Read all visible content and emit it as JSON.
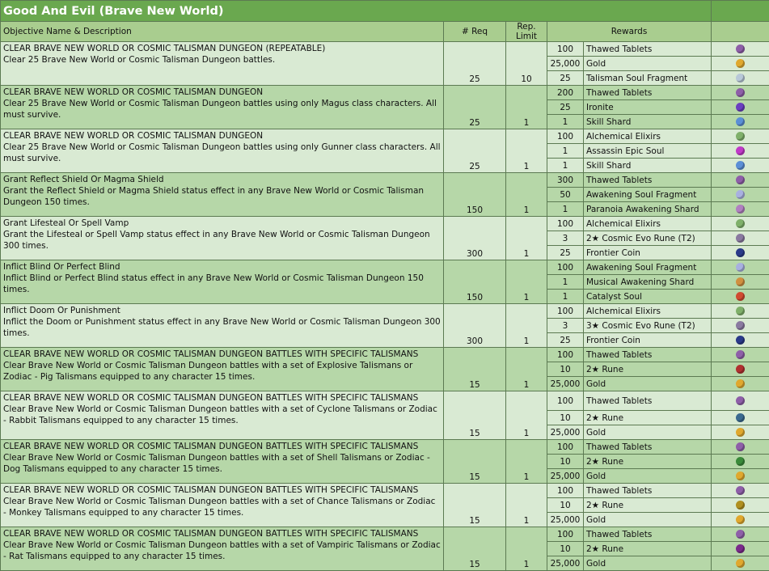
{
  "title": "Good And Evil (Brave New World)",
  "headers": {
    "objective": "Objective Name & Description",
    "req": "# Req",
    "limit": "Rep. Limit",
    "rewards": "Rewards"
  },
  "objectives": [
    {
      "name": "CLEAR BRAVE NEW WORLD OR COSMIC TALISMAN DUNGEON (REPEATABLE)",
      "description": "Clear 25 Brave New World or Cosmic Talisman Dungeon battles.",
      "req": "25",
      "limit": "10",
      "rewards": [
        {
          "amount": "100",
          "name": "Thawed Tablets",
          "icon": "thawed-tablets-icon",
          "color": "#8e5fa8"
        },
        {
          "amount": "25,000",
          "name": "Gold",
          "icon": "gold-icon",
          "color": "#e0a82e"
        },
        {
          "amount": "25",
          "name": "Talisman Soul Fragment",
          "icon": "talisman-soul-fragment-icon",
          "color": "#b8c8d8"
        }
      ]
    },
    {
      "name": "CLEAR BRAVE NEW WORLD OR COSMIC TALISMAN DUNGEON",
      "description": "Clear 25 Brave New World or Cosmic Talisman Dungeon battles using only Magus class characters. All must survive.",
      "req": "25",
      "limit": "1",
      "rewards": [
        {
          "amount": "200",
          "name": "Thawed Tablets",
          "icon": "thawed-tablets-icon",
          "color": "#8e5fa8"
        },
        {
          "amount": "25",
          "name": "Ironite",
          "icon": "ironite-icon",
          "color": "#6a3fc0"
        },
        {
          "amount": "1",
          "name": "Skill Shard",
          "icon": "skill-shard-icon",
          "color": "#5b8fd6"
        }
      ]
    },
    {
      "name": "CLEAR BRAVE NEW WORLD OR COSMIC TALISMAN DUNGEON",
      "description": "Clear 25 Brave New World or Cosmic Talisman Dungeon battles using only Gunner class characters. All must survive.",
      "req": "25",
      "limit": "1",
      "rewards": [
        {
          "amount": "100",
          "name": "Alchemical Elixirs",
          "icon": "alchemical-elixirs-icon",
          "color": "#7fb06a"
        },
        {
          "amount": "1",
          "name": "Assassin Epic Soul",
          "icon": "assassin-epic-soul-icon",
          "color": "#c03ac8"
        },
        {
          "amount": "1",
          "name": "Skill Shard",
          "icon": "skill-shard-icon",
          "color": "#5b8fd6"
        }
      ]
    },
    {
      "name": "Grant Reflect Shield Or Magma Shield",
      "description": "Grant the Reflect Shield or Magma Shield status effect in any Brave New World or Cosmic Talisman Dungeon 150 times.",
      "req": "150",
      "limit": "1",
      "rewards": [
        {
          "amount": "300",
          "name": "Thawed Tablets",
          "icon": "thawed-tablets-icon",
          "color": "#8e5fa8"
        },
        {
          "amount": "50",
          "name": "Awakening Soul Fragment",
          "icon": "awakening-soul-fragment-icon",
          "color": "#a8b0e0"
        },
        {
          "amount": "1",
          "name": "Paranoia Awakening Shard",
          "icon": "paranoia-awakening-shard-icon",
          "color": "#b080c0"
        }
      ]
    },
    {
      "name": "Grant Lifesteal Or Spell Vamp",
      "description": "Grant the Lifesteal or Spell Vamp status effect in any Brave New World or Cosmic Talisman Dungeon 300 times.",
      "req": "300",
      "limit": "1",
      "rewards": [
        {
          "amount": "100",
          "name": "Alchemical Elixirs",
          "icon": "alchemical-elixirs-icon",
          "color": "#7fb06a"
        },
        {
          "amount": "3",
          "name": "2★ Cosmic Evo Rune (T2)",
          "icon": "cosmic-evo-rune-icon",
          "color": "#8a7aa0"
        },
        {
          "amount": "25",
          "name": "Frontier Coin",
          "icon": "frontier-coin-icon",
          "color": "#2a3a8a"
        }
      ]
    },
    {
      "name": "Inflict Blind Or Perfect Blind",
      "description": "Inflict Blind or Perfect Blind status effect in any Brave New World or Cosmic Talisman Dungeon 150 times.",
      "req": "150",
      "limit": "1",
      "rewards": [
        {
          "amount": "100",
          "name": "Awakening Soul Fragment",
          "icon": "awakening-soul-fragment-icon",
          "color": "#a8b0e0"
        },
        {
          "amount": "1",
          "name": "Musical Awakening Shard",
          "icon": "musical-awakening-shard-icon",
          "color": "#d09040"
        },
        {
          "amount": "1",
          "name": "Catalyst Soul",
          "icon": "catalyst-soul-icon",
          "color": "#d04a30"
        }
      ]
    },
    {
      "name": "Inflict Doom Or Punishment",
      "description": "Inflict the Doom or Punishment status effect in any Brave New World or Cosmic Talisman Dungeon 300 times.",
      "req": "300",
      "limit": "1",
      "rewards": [
        {
          "amount": "100",
          "name": "Alchemical Elixirs",
          "icon": "alchemical-elixirs-icon",
          "color": "#7fb06a"
        },
        {
          "amount": "3",
          "name": "3★ Cosmic Evo Rune (T2)",
          "icon": "cosmic-evo-rune-icon",
          "color": "#8a7aa0"
        },
        {
          "amount": "25",
          "name": "Frontier Coin",
          "icon": "frontier-coin-icon",
          "color": "#2a3a8a"
        }
      ]
    },
    {
      "name": "CLEAR BRAVE NEW WORLD OR COSMIC TALISMAN DUNGEON BATTLES WITH SPECIFIC TALISMANS",
      "description": "Clear Brave New World or Cosmic Talisman Dungeon battles with a set of Explosive Talismans or Zodiac -  Pig Talismans equipped to any character 15 times.",
      "req": "15",
      "limit": "1",
      "rewards": [
        {
          "amount": "100",
          "name": "Thawed Tablets",
          "icon": "thawed-tablets-icon",
          "color": "#8e5fa8"
        },
        {
          "amount": "10",
          "name": "2★ Rune",
          "icon": "rune-icon",
          "color": "#b03030"
        },
        {
          "amount": "25,000",
          "name": "Gold",
          "icon": "gold-icon",
          "color": "#e0a82e"
        }
      ]
    },
    {
      "name": "CLEAR BRAVE NEW WORLD OR COSMIC TALISMAN DUNGEON BATTLES WITH SPECIFIC TALISMANS",
      "description": "Clear Brave New World or Cosmic Talisman Dungeon battles with a set of Cyclone Talismans or Zodiac - Rabbit Talismans equipped to any character 15 times.",
      "req": "15",
      "limit": "1",
      "rewards": [
        {
          "amount": "100",
          "name": "Thawed Tablets",
          "icon": "thawed-tablets-icon",
          "color": "#8e5fa8"
        },
        {
          "amount": "10",
          "name": "2★ Rune",
          "icon": "rune-icon",
          "color": "#3a6a90"
        },
        {
          "amount": "25,000",
          "name": "Gold",
          "icon": "gold-icon",
          "color": "#e0a82e"
        }
      ]
    },
    {
      "name": "CLEAR BRAVE NEW WORLD OR COSMIC TALISMAN DUNGEON BATTLES WITH SPECIFIC TALISMANS",
      "description": "Clear Brave New World or Cosmic Talisman Dungeon battles with a set of Shell Talismans or Zodiac -  Dog Talismans equipped to any character 15 times.",
      "req": "15",
      "limit": "1",
      "rewards": [
        {
          "amount": "100",
          "name": "Thawed Tablets",
          "icon": "thawed-tablets-icon",
          "color": "#8e5fa8"
        },
        {
          "amount": "10",
          "name": "2★ Rune",
          "icon": "rune-icon",
          "color": "#3a8a3a"
        },
        {
          "amount": "25,000",
          "name": "Gold",
          "icon": "gold-icon",
          "color": "#e0a82e"
        }
      ]
    },
    {
      "name": "CLEAR BRAVE NEW WORLD OR COSMIC TALISMAN DUNGEON BATTLES WITH SPECIFIC TALISMANS",
      "description": "Clear Brave New World or Cosmic Talisman Dungeon battles with a set of Chance Talismans or Zodiac - Monkey Talismans equipped to any character 15 times.",
      "req": "15",
      "limit": "1",
      "rewards": [
        {
          "amount": "100",
          "name": "Thawed Tablets",
          "icon": "thawed-tablets-icon",
          "color": "#8e5fa8"
        },
        {
          "amount": "10",
          "name": "2★ Rune",
          "icon": "rune-icon",
          "color": "#b09020"
        },
        {
          "amount": "25,000",
          "name": "Gold",
          "icon": "gold-icon",
          "color": "#e0a82e"
        }
      ]
    },
    {
      "name": "CLEAR BRAVE NEW WORLD OR COSMIC TALISMAN DUNGEON BATTLES WITH SPECIFIC TALISMANS",
      "description": "Clear Brave New World or Cosmic Talisman Dungeon battles with a set of Vampiric Talismans or Zodiac -  Rat Talismans equipped to any character 15 times.",
      "req": "15",
      "limit": "1",
      "rewards": [
        {
          "amount": "100",
          "name": "Thawed Tablets",
          "icon": "thawed-tablets-icon",
          "color": "#8e5fa8"
        },
        {
          "amount": "10",
          "name": "2★ Rune",
          "icon": "rune-icon",
          "color": "#7a2a8a"
        },
        {
          "amount": "25,000",
          "name": "Gold",
          "icon": "gold-icon",
          "color": "#e0a82e"
        }
      ]
    }
  ]
}
